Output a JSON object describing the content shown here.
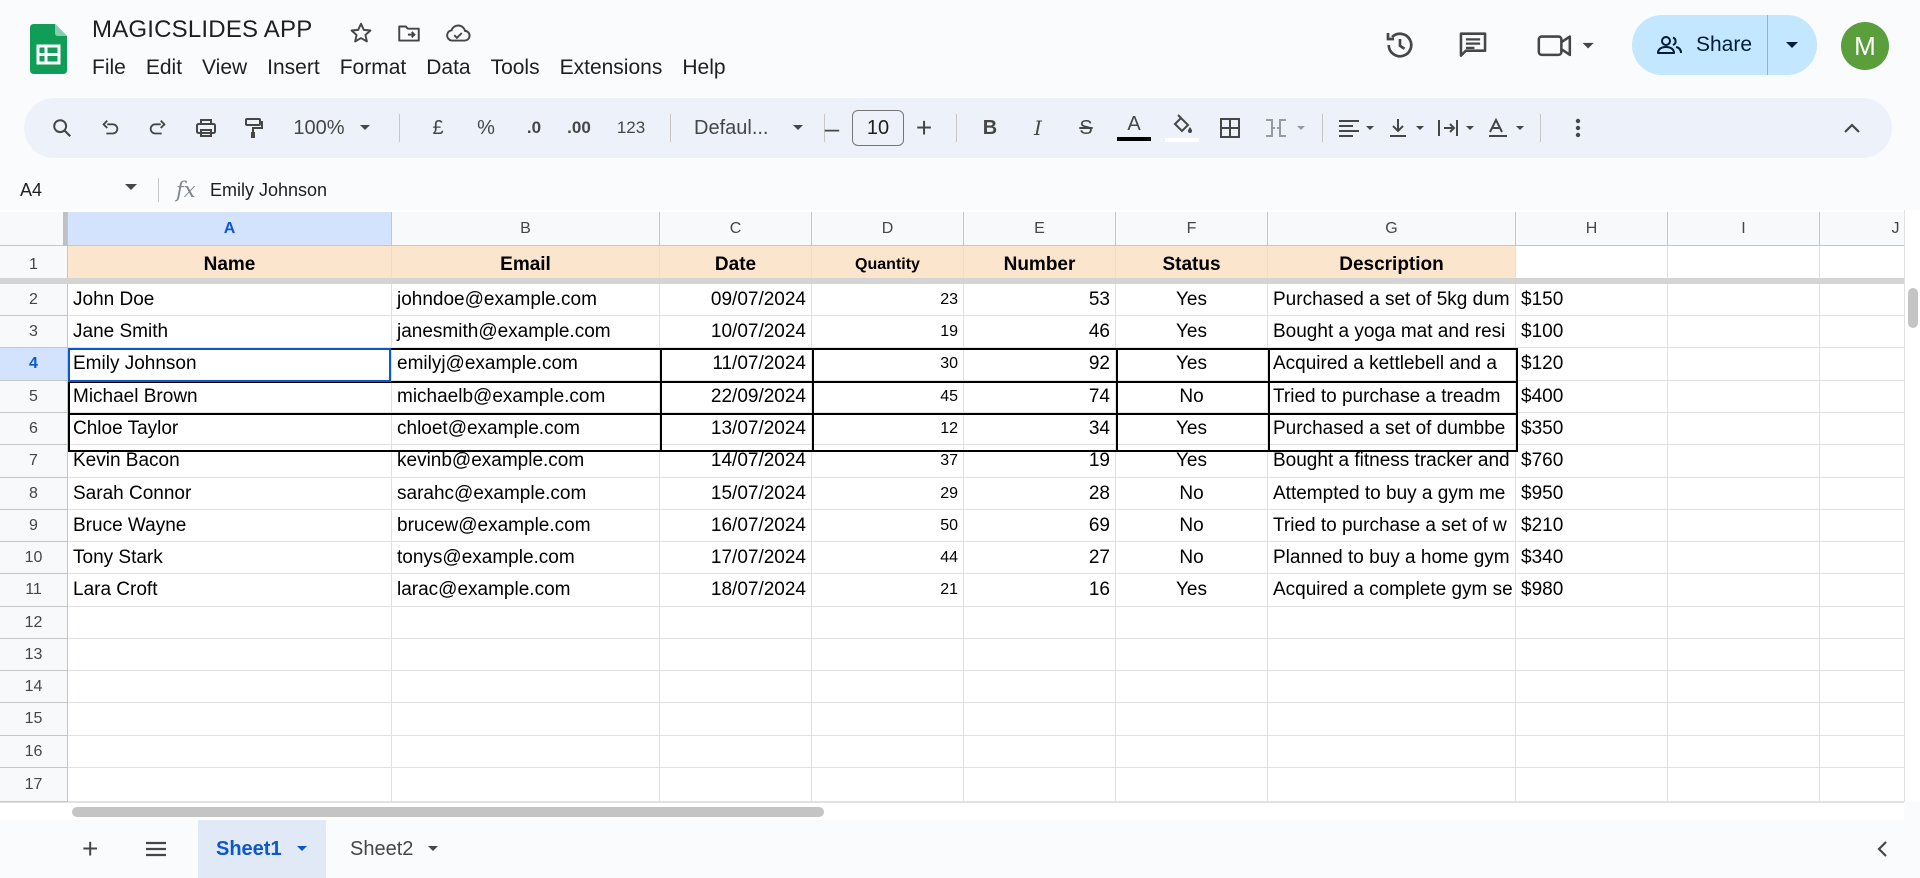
{
  "app": {
    "doc_title": "MAGICSLIDES APP",
    "menu": [
      "File",
      "Edit",
      "View",
      "Insert",
      "Format",
      "Data",
      "Tools",
      "Extensions",
      "Help"
    ],
    "share_label": "Share",
    "avatar_letter": "M",
    "icons": [
      "sheets-logo-icon",
      "star-icon",
      "move-to-folder-icon",
      "cloud-status-icon",
      "version-history-icon",
      "comments-icon",
      "meet-camera-icon",
      "share-people-icon",
      "chevron-down-icon"
    ]
  },
  "toolbar": {
    "zoom": "100%",
    "currency": "£",
    "percent": "%",
    "decrease_decimal": ".0",
    "increase_decimal": ".00",
    "number_format": "123",
    "font_family": "Defaul...",
    "font_size": "10",
    "minus": "–",
    "plus": "+",
    "bold": "B",
    "italic": "I",
    "strike": "S",
    "text_color_letter": "A",
    "text_color": "#000000",
    "icons": [
      "search-icon",
      "undo-icon",
      "redo-icon",
      "print-icon",
      "paint-format-icon",
      "fill-color-icon",
      "borders-icon",
      "merge-cells-icon",
      "align-left-icon",
      "vertical-align-icon",
      "text-wrap-icon",
      "text-rotation-icon",
      "more-icon",
      "collapse-icon"
    ]
  },
  "formula_bar": {
    "name_box": "A4",
    "fx": "fx",
    "value": "Emily Johnson"
  },
  "grid": {
    "columns": [
      "A",
      "B",
      "C",
      "D",
      "E",
      "F",
      "G",
      "H",
      "I",
      "J"
    ],
    "selected_column": "A",
    "row_numbers": [
      "1",
      "2",
      "3",
      "4",
      "5",
      "6",
      "7",
      "8",
      "9",
      "10",
      "11",
      "12",
      "13",
      "14",
      "15",
      "16",
      "17"
    ],
    "selected_row": "4",
    "header_fill": "#fce5cd",
    "headers": [
      "Name",
      "Email",
      "Date",
      "Quantity",
      "Number",
      "Status",
      "Description"
    ],
    "rows": [
      [
        "John Doe",
        "johndoe@example.com",
        "09/07/2024",
        "23",
        "53",
        "Yes",
        "Purchased a set of 5kg dum",
        "$150"
      ],
      [
        "Jane Smith",
        "janesmith@example.com",
        "10/07/2024",
        "19",
        "46",
        "Yes",
        "Bought a yoga mat and resi",
        "$100"
      ],
      [
        "Emily Johnson",
        "emilyj@example.com",
        "11/07/2024",
        "30",
        "92",
        "Yes",
        "Acquired a kettlebell and a",
        "$120"
      ],
      [
        "Michael Brown",
        "michaelb@example.com",
        "22/09/2024",
        "45",
        "74",
        "No",
        "Tried to purchase a treadm",
        "$400"
      ],
      [
        "Chloe Taylor",
        "chloet@example.com",
        "13/07/2024",
        "12",
        "34",
        "Yes",
        "Purchased a set of dumbbe",
        "$350"
      ],
      [
        "Kevin Bacon",
        "kevinb@example.com",
        "14/07/2024",
        "37",
        "19",
        "Yes",
        "Bought a fitness tracker and",
        "$760"
      ],
      [
        "Sarah Connor",
        "sarahc@example.com",
        "15/07/2024",
        "29",
        "28",
        "No",
        "Attempted to buy a gym me",
        "$950"
      ],
      [
        "Bruce Wayne",
        "brucew@example.com",
        "16/07/2024",
        "50",
        "69",
        "No",
        "Tried to purchase a set of w",
        "$210"
      ],
      [
        "Tony Stark",
        "tonys@example.com",
        "17/07/2024",
        "44",
        "27",
        "No",
        "Planned to buy a home gym",
        "$340"
      ],
      [
        "Lara Croft",
        "larac@example.com",
        "18/07/2024",
        "21",
        "16",
        "Yes",
        "Acquired a complete gym se",
        "$980"
      ]
    ]
  },
  "sheets": {
    "add": "+",
    "tabs": [
      "Sheet1",
      "Sheet2"
    ],
    "active_tab": "Sheet1"
  }
}
